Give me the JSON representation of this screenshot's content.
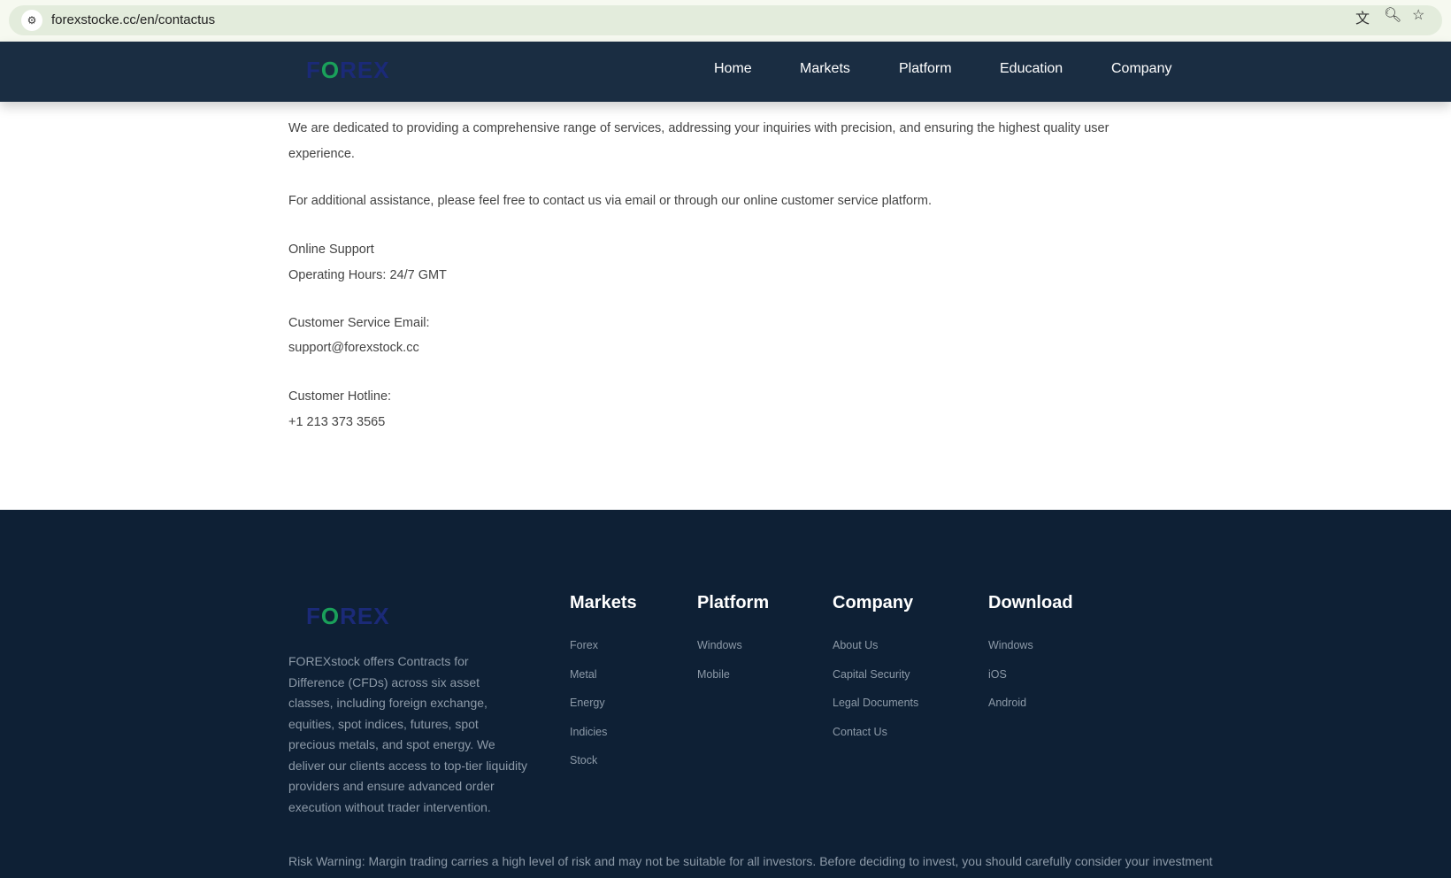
{
  "browser": {
    "url": "forexstocke.cc/en/contactus"
  },
  "header": {
    "logo": "FOREX",
    "nav": [
      "Home",
      "Markets",
      "Platform",
      "Education",
      "Company"
    ]
  },
  "content": {
    "para1_line1": "We are dedicated to providing a comprehensive range of services, addressing your inquiries with precision, and ensuring the highest quality user",
    "para1_line2": "experience.",
    "para2": "For additional assistance, please feel free to contact us via email or through our online customer service platform.",
    "online_support": "Online Support",
    "hours": "Operating Hours: 24/7 GMT",
    "email_label": "Customer Service Email:",
    "email": "support@forexstock.cc",
    "hotline_label": "Customer Hotline:",
    "hotline": "+1 213 373 3565"
  },
  "footer": {
    "logo": "FOREX",
    "description": "FOREXstock offers Contracts for Difference (CFDs) across six asset classes, including foreign exchange, equities, spot indices, futures, spot precious metals, and spot energy. We deliver our clients access to top-tier liquidity providers and ensure advanced order execution without trader intervention.",
    "columns": [
      {
        "title": "Markets",
        "links": [
          "Forex",
          "Metal",
          "Energy",
          "Indicies",
          "Stock"
        ]
      },
      {
        "title": "Platform",
        "links": [
          "Windows",
          "Mobile"
        ]
      },
      {
        "title": "Company",
        "links": [
          "About Us",
          "Capital Security",
          "Legal Documents",
          "Contact Us"
        ]
      },
      {
        "title": "Download",
        "links": [
          "Windows",
          "iOS",
          "Android"
        ]
      }
    ],
    "risk": "Risk Warning: Margin trading carries a high level of risk and may not be suitable for all investors. Before deciding to invest, you should carefully consider your investment"
  }
}
